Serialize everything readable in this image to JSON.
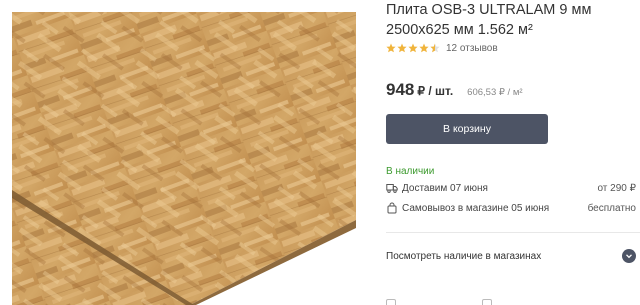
{
  "product": {
    "title": "Плита OSB-3 ULTRALAM 9 мм 2500x625 мм 1.562 м²",
    "rating": 4.5,
    "reviews_label": "12 отзывов",
    "image_alt": "OSB board photo"
  },
  "price": {
    "value": "948",
    "unit": "₽ / шт.",
    "alt_price": "606,53 ₽ / м²"
  },
  "actions": {
    "cart_label": "В корзину"
  },
  "availability": {
    "status": "В наличии",
    "delivery_label": "Доставим 07 июня",
    "delivery_value": "от 290 ₽",
    "pickup_label": "Самовывоз в магазине 05 июня",
    "pickup_value": "бесплатно"
  },
  "stores": {
    "check_label": "Посмотреть наличие в магазинах"
  },
  "colors": {
    "button_bg": "#4d5465",
    "stock_green": "#3c9a2e",
    "star_gold": "#f0b43c"
  },
  "icons": {
    "delivery": "truck-icon",
    "pickup": "bag-icon",
    "expand": "chevron-down-icon",
    "rating": "star-icon"
  }
}
